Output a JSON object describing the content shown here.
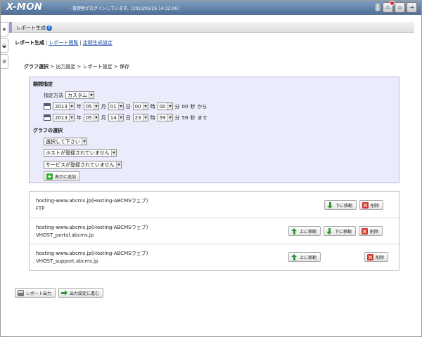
{
  "header": {
    "logo": "X-MON",
    "login_msg": "- 管理者がログインしています。(2013/05/26 14:32:06)",
    "icons": [
      "database-icon",
      "alert-icon",
      "home-icon",
      "logout-icon"
    ]
  },
  "side_tabs": [
    "★",
    "◒",
    "⚙"
  ],
  "title": "レポート生成",
  "help": "?",
  "subnav": {
    "current": "レポート生成",
    "links": [
      "レポート閲覧",
      "定期生成設定"
    ]
  },
  "breadcrumb": {
    "current": "グラフ選択",
    "rest": " > 出力設定 > レポート設定 > 保存"
  },
  "period": {
    "title": "期間指定",
    "method_label": "指定方法",
    "method_value": "カスタム",
    "start": {
      "year": "2013",
      "month": "05",
      "day": "01",
      "hour": "00",
      "minute": "00",
      "second": "00",
      "suffix": "から"
    },
    "end": {
      "year": "2013",
      "month": "05",
      "day": "14",
      "hour": "23",
      "minute": "59",
      "second": "59",
      "suffix": "まで"
    },
    "units": {
      "year": "年",
      "month": "月",
      "day": "日",
      "hour": "時",
      "minute": "分",
      "second": "秒"
    }
  },
  "graph_select": {
    "title": "グラフの選択",
    "select1": "選択して下さい",
    "select2": "ホストが登録されていません",
    "select3": "サービスが登録されていません",
    "add_button": "表示に追加"
  },
  "graphs": [
    {
      "host": "hosting-www.abcms.jp(Hosting-ABCMSウェブ)",
      "service": "FTP"
    },
    {
      "host": "hosting-www.abcms.jp(Hosting-ABCMSウェブ)",
      "service": "VHOST_portal.abcms.jp"
    },
    {
      "host": "hosting-www.abcms.jp(Hosting-ABCMSウェブ)",
      "service": "VHOST_support.abcms.jp"
    }
  ],
  "buttons": {
    "up": "上に移動",
    "down": "下に移動",
    "delete": "削除",
    "report_output": "レポート出力",
    "next": "出力設定に進む"
  }
}
